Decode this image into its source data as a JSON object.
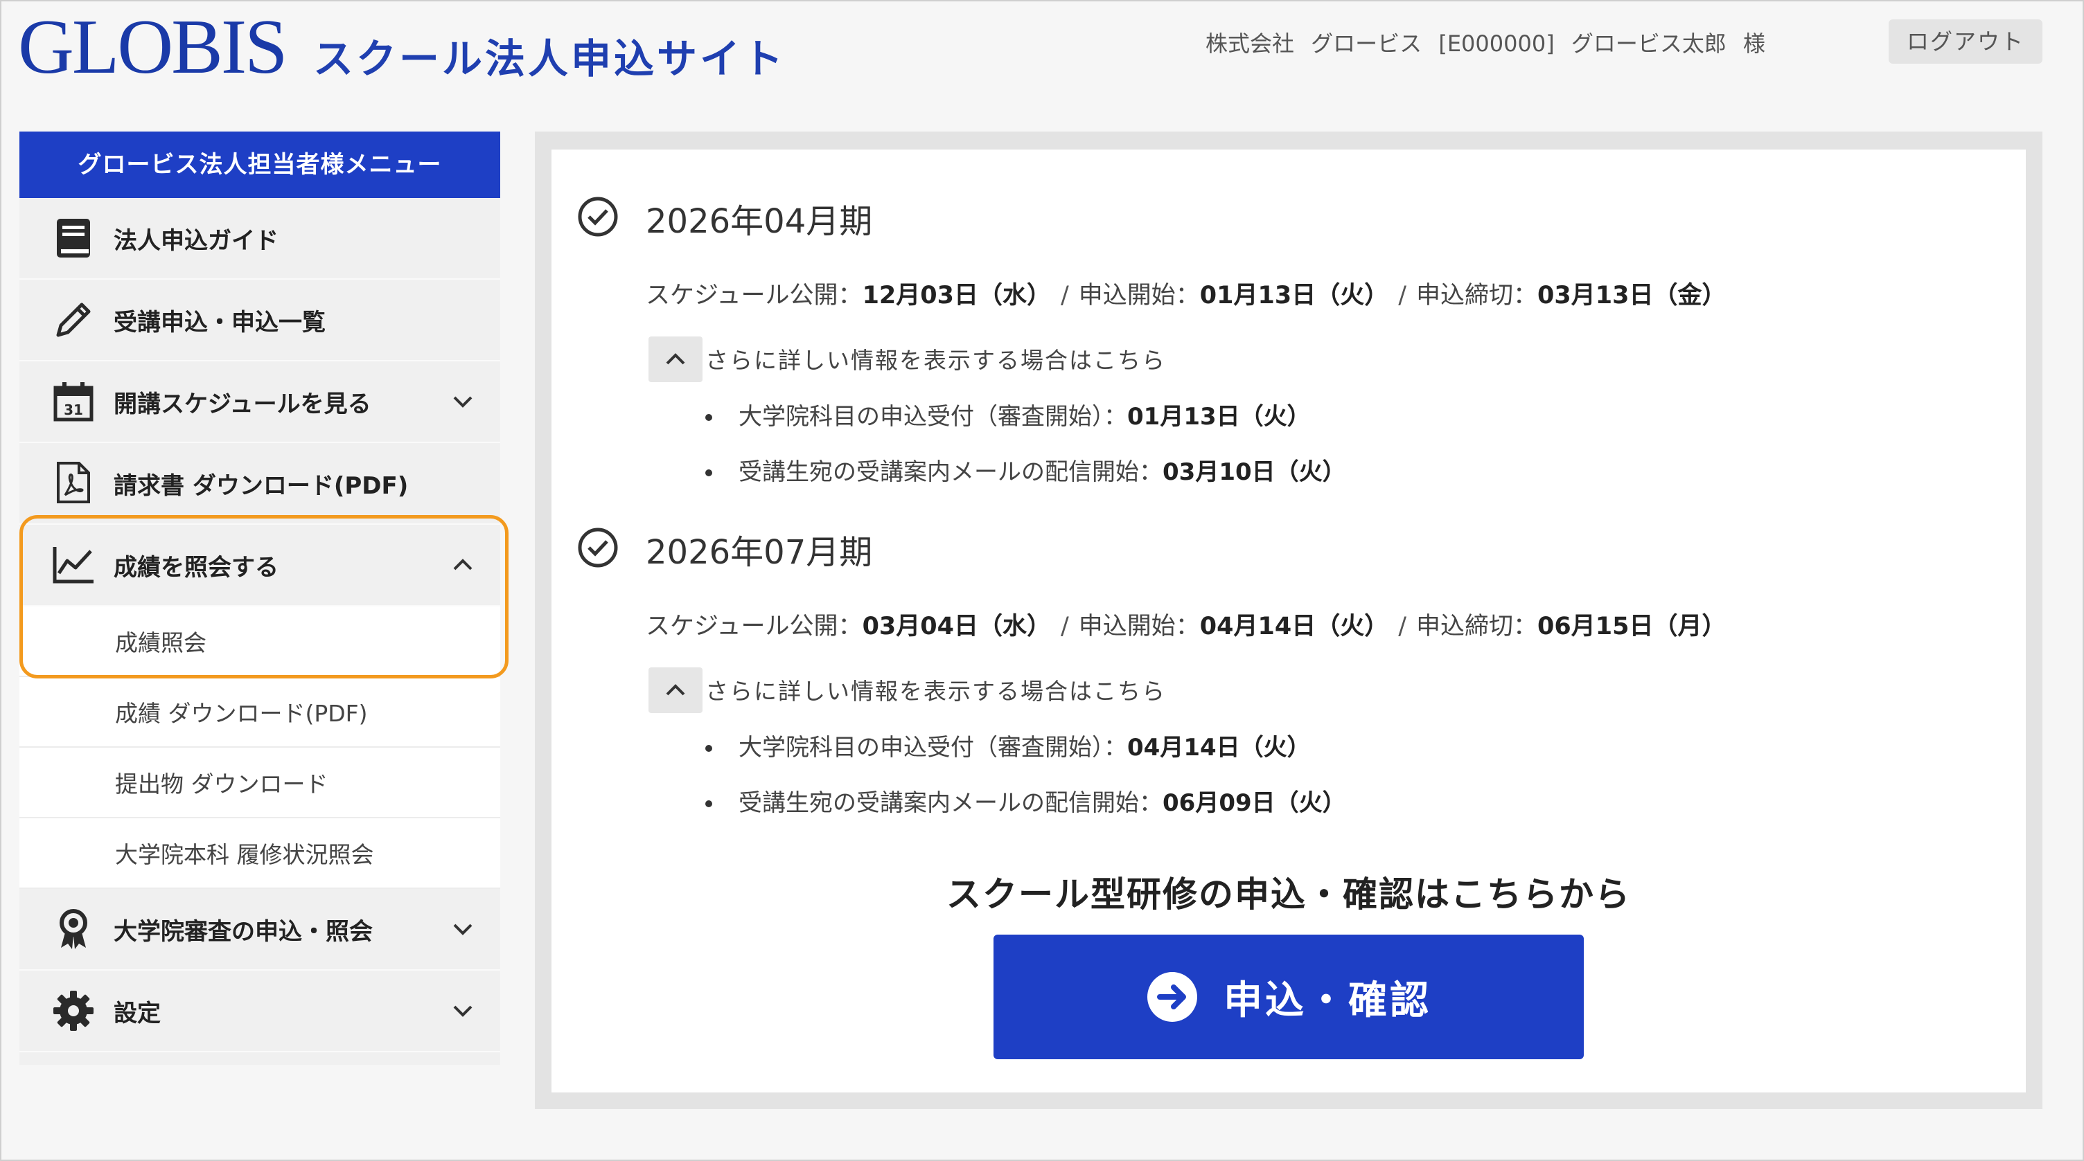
{
  "header": {
    "logo": "GLOBIS",
    "site_title": "スクール法人申込サイト",
    "user_info": "株式会社 グロービス [E000000] グロービス太郎 様",
    "logout_label": "ログアウト"
  },
  "sidebar": {
    "title": "グロービス法人担当者様メニュー",
    "items": [
      {
        "label": "法人申込ガイド",
        "icon": "book-icon"
      },
      {
        "label": "受講申込・申込一覧",
        "icon": "pencil-icon"
      },
      {
        "label": "開講スケジュールを見る",
        "icon": "calendar-icon",
        "calendar_day": "31"
      },
      {
        "label": "請求書 ダウンロード(PDF)",
        "icon": "pdf-file-icon"
      },
      {
        "label": "成績を照会する",
        "icon": "chart-line-icon",
        "expanded": true
      },
      {
        "label": "大学院審査の申込・照会",
        "icon": "award-icon"
      },
      {
        "label": "設定",
        "icon": "gear-icon"
      }
    ],
    "subitems": [
      "成績照会",
      "成績 ダウンロード(PDF)",
      "提出物 ダウンロード",
      "大学院本科 履修状況照会"
    ],
    "highlight_color": "#f39a1e"
  },
  "terms": [
    {
      "title": "2026年04月期",
      "publish_label": "スケジュール公開：",
      "publish_value": "12月03日（水）",
      "apply_start_label": "申込開始：",
      "apply_start_value": "01月13日（火）",
      "apply_end_label": "申込締切：",
      "apply_end_value": "03月13日（金）",
      "more_info": "さらに詳しい情報を表示する場合はこちら",
      "details": [
        {
          "label": "大学院科目の申込受付（審査開始）：",
          "value": "01月13日（火）"
        },
        {
          "label": "受講生宛の受講案内メールの配信開始：",
          "value": "03月10日（火）"
        }
      ]
    },
    {
      "title": "2026年07月期",
      "publish_label": "スケジュール公開：",
      "publish_value": "03月04日（水）",
      "apply_start_label": "申込開始：",
      "apply_start_value": "04月14日（火）",
      "apply_end_label": "申込締切：",
      "apply_end_value": "06月15日（月）",
      "more_info": "さらに詳しい情報を表示する場合はこちら",
      "details": [
        {
          "label": "大学院科目の申込受付（審査開始）：",
          "value": "04月14日（火）"
        },
        {
          "label": "受講生宛の受講案内メールの配信開始：",
          "value": "06月09日（火）"
        }
      ]
    }
  ],
  "separator": "/",
  "cta": {
    "heading": "スクール型研修の申込・確認はこちらから",
    "button_label": "申込・確認"
  },
  "colors": {
    "brand_blue": "#1e3fc5",
    "highlight_orange": "#f39a1e"
  }
}
